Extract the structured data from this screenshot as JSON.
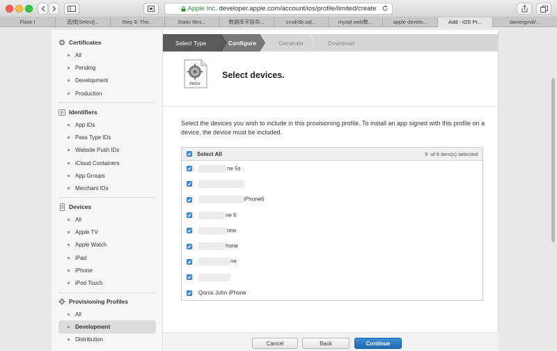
{
  "browser": {
    "address": {
      "company": "Apple Inc.",
      "url": "developer.apple.com/account/ios/profile/limited/create"
    },
    "tabs": [
      {
        "label": "Flask I",
        "active": false
      },
      {
        "label": "选择[Select]...",
        "active": false
      },
      {
        "label": "Step 6: The...",
        "active": false
      },
      {
        "label": "Static files...",
        "active": false
      },
      {
        "label": "数据库字段命...",
        "active": false
      },
      {
        "label": "crud/db.sql...",
        "active": false
      },
      {
        "label": "mysql web数...",
        "active": false
      },
      {
        "label": "apple develo...",
        "active": false
      },
      {
        "label": "Add - iOS Pr...",
        "active": true
      },
      {
        "label": "danieigindi/...",
        "active": false
      }
    ]
  },
  "sidebar": {
    "certificates": {
      "title": "Certificates",
      "items": [
        "All",
        "Pending",
        "Development",
        "Production"
      ]
    },
    "identifiers": {
      "title": "Identifiers",
      "badge": "ID",
      "items": [
        "App IDs",
        "Pass Type IDs",
        "Website Push IDs",
        "iCloud Containers",
        "App Groups",
        "Merchant IDs"
      ]
    },
    "devices": {
      "title": "Devices",
      "items": [
        "All",
        "Apple TV",
        "Apple Watch",
        "iPad",
        "iPhone",
        "iPod Touch"
      ]
    },
    "profiles": {
      "title": "Provisioning Profiles",
      "items": [
        "All",
        "Development",
        "Distribution"
      ],
      "selected": "Development"
    }
  },
  "steps": [
    "Select Type",
    "Configure",
    "Generate",
    "Download"
  ],
  "main": {
    "icon_label": "PROV",
    "heading": "Select devices.",
    "description": "Select the devices you wish to include in this provisioning profile. To install an app signed with this profile on a device, the device must be included.",
    "select_all": "Select All",
    "count_selected": "9",
    "count_text": "of 9 item(s) selected",
    "devices": [
      {
        "visible_text": "ne 5s",
        "checked": true
      },
      {
        "visible_text": "",
        "checked": true
      },
      {
        "visible_text": "iPhone6",
        "checked": true
      },
      {
        "visible_text": "ne 6",
        "checked": true
      },
      {
        "visible_text": "one",
        "checked": true
      },
      {
        "visible_text": "hone",
        "checked": true
      },
      {
        "visible_text": "ne",
        "checked": true
      },
      {
        "visible_text": "",
        "checked": true
      },
      {
        "visible_text": "Qoros John iPhone",
        "checked": true
      }
    ]
  },
  "buttons": {
    "cancel": "Cancel",
    "back": "Back",
    "continue": "Continue"
  }
}
